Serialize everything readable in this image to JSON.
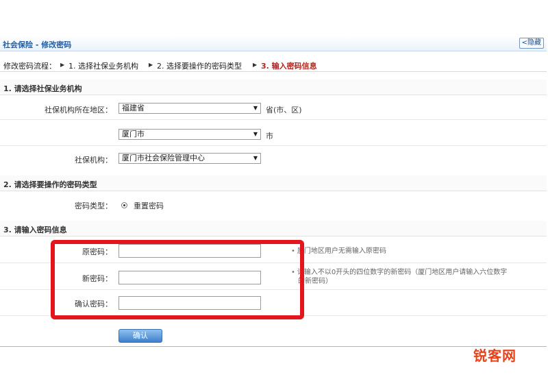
{
  "window": {
    "title": "社会保险 - 修改密码",
    "collapse_label": "<隐藏"
  },
  "breadcrumb": {
    "prefix": "修改密码流程：",
    "steps": [
      "1. 选择社保业务机构",
      "2. 选择要操作的密码类型",
      "3. 输入密码信息"
    ],
    "separator": "▶"
  },
  "section1": {
    "heading": "1. 请选择社保业务机构",
    "region_label": "社保机构所在地区：",
    "province_value": "福建省",
    "province_suffix": "省(市、区)",
    "city_value": "厦门市",
    "city_suffix": "市",
    "agency_label": "社保机构：",
    "agency_value": "厦门市社会保险管理中心"
  },
  "section2": {
    "heading": "2. 请选择要操作的密码类型",
    "type_label": "密码类型：",
    "option_label": "重置密码"
  },
  "section3": {
    "heading": "3. 请输入密码信息",
    "old_label": "原密码：",
    "new_label": "新密码：",
    "confirm_label": "确认密码：",
    "old_hint": "厦门地区用户无需输入原密码",
    "new_hint_1": "请输入不以0开头的四位数字的新密码（厦门地区用户请输入六位数字",
    "new_hint_2": "的新密码）"
  },
  "actions": {
    "confirm_label": "确认"
  },
  "watermark": "锐客网",
  "colors": {
    "accent": "#1f5fa8",
    "active_step": "#b3261e",
    "highlight": "#e4161d"
  }
}
